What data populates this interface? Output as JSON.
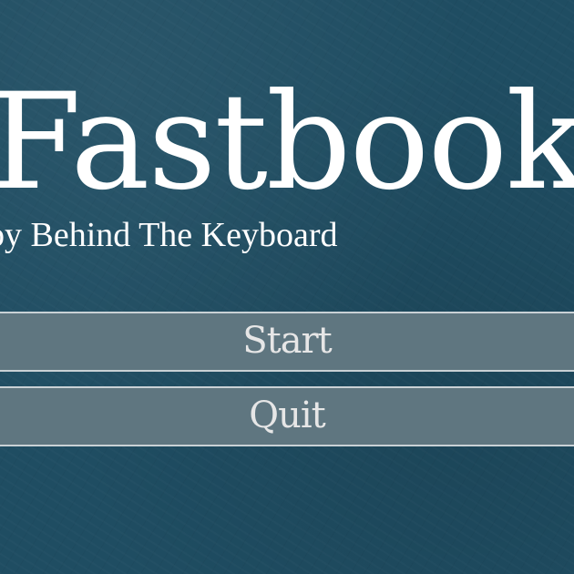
{
  "game": {
    "title": "Fastbook",
    "subtitle": "by Behind The Keyboard"
  },
  "menu": {
    "start_label": "Start",
    "quit_label": "Quit"
  },
  "colors": {
    "background": "#1f4d62",
    "button_fill": "#5f7680",
    "button_border": "#c9d1d5",
    "title_text": "#ffffff",
    "button_text": "#e6e6e6"
  }
}
